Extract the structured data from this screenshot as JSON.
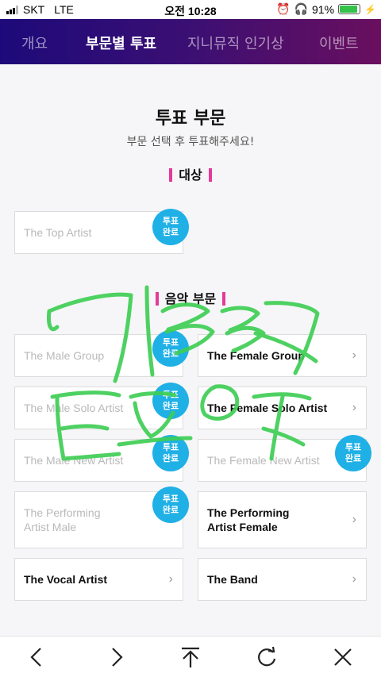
{
  "status": {
    "carrier": "SKT",
    "network": "LTE",
    "time": "오전 10:28",
    "battery_pct": "91%",
    "battery_level": 0.91
  },
  "nav": {
    "tabs": [
      {
        "label": "개요"
      },
      {
        "label": "부문별 투표",
        "active": true
      },
      {
        "label": "지니뮤직 인기상"
      },
      {
        "label": "이벤트"
      }
    ]
  },
  "main": {
    "title": "투표 부문",
    "subtitle": "부문 선택 후 투표해주세요!",
    "grand": {
      "heading": "대상",
      "items": [
        {
          "label": "The Top Artist",
          "badge": [
            "투표",
            "완료"
          ]
        }
      ]
    },
    "music": {
      "heading": "음악 부문",
      "items": [
        {
          "label": "The Male Group",
          "badge": [
            "투표",
            "완료"
          ]
        },
        {
          "label": "The Female Group"
        },
        {
          "label": "The Male Solo Artist",
          "badge": [
            "투표",
            "완료"
          ]
        },
        {
          "label": "The Female Solo Artist"
        },
        {
          "label": "The Male New Artist",
          "badge": [
            "투표",
            "완료"
          ]
        },
        {
          "label": "The Female New Artist",
          "badge": [
            "투표",
            "완료"
          ]
        },
        {
          "label": [
            "The Performing",
            "Artist Male"
          ],
          "badge": [
            "투표",
            "완료"
          ]
        },
        {
          "label": [
            "The Performing",
            "Artist Female"
          ]
        },
        {
          "label": "The Vocal Artist"
        },
        {
          "label": "The Band"
        }
      ]
    }
  },
  "toolbar": {
    "icons": [
      "back-icon",
      "forward-icon",
      "share-icon",
      "reload-icon",
      "close-icon"
    ]
  },
  "colors": {
    "accent": "#e43a9a",
    "badge": "#1fb0e6",
    "scribble": "#3fce55",
    "nav_start": "#1d0a7a",
    "nav_end": "#6a0f5e"
  }
}
